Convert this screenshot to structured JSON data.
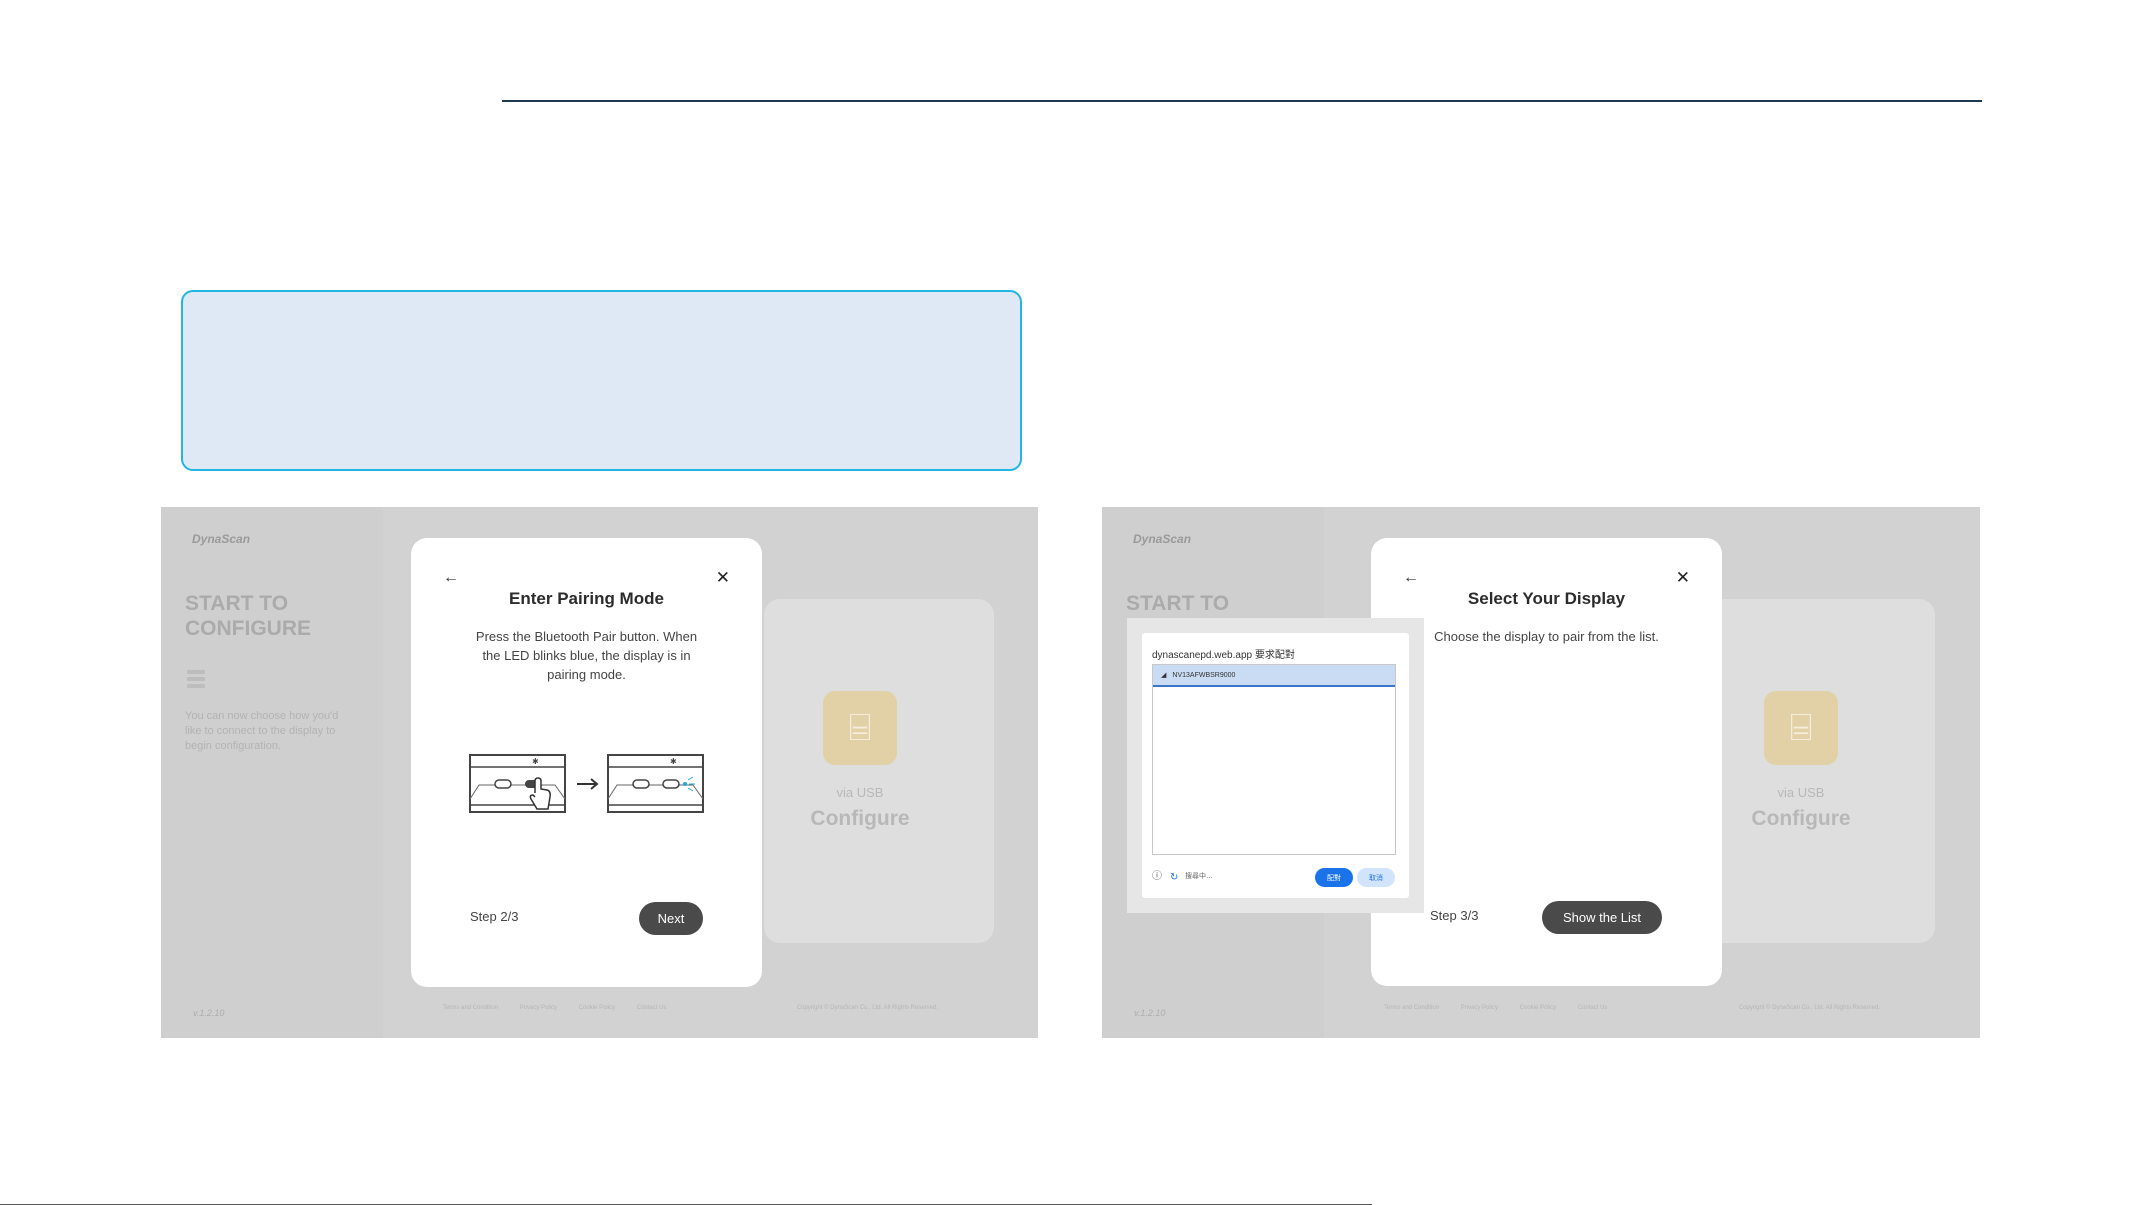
{
  "left_screen": {
    "brand": "DynaScan",
    "start_title": "START TO CONFIGURE",
    "side_description": "You can now choose how you'd like to connect to the display to begin configuration.",
    "version": "v.1.2.10",
    "footer_links": [
      "Terms and Condition",
      "Privacy Policy",
      "Cookie Policy",
      "Contact Us"
    ],
    "copyright": "Copyright © DynaScan Co., Ltd. All Rights Reserved.",
    "usb_card": {
      "via": "via USB",
      "title": "Configure"
    },
    "modal": {
      "title": "Enter Pairing Mode",
      "description": "Press the Bluetooth Pair button. When the LED blinks blue, the display is in pairing mode.",
      "step": "Step 2/3",
      "next_label": "Next"
    }
  },
  "right_screen": {
    "brand": "DynaScan",
    "start_title": "START TO",
    "version": "v.1.2.10",
    "footer_links": [
      "Terms and Condition",
      "Privacy Policy",
      "Cookie Policy",
      "Contact Us"
    ],
    "copyright": "Copyright © DynaScan Co., Ltd. All Rights Reserved.",
    "usb_card": {
      "via": "via USB",
      "title": "Configure"
    },
    "modal": {
      "title": "Select Your Display",
      "description": "Choose the display to pair from the list.",
      "step": "Step 3/3",
      "show_list_label": "Show the List"
    },
    "chooser": {
      "title": "dynascanepd.web.app 要求配對",
      "device": "NV13AFWBSR9000",
      "status": "搜尋中…",
      "pair_label": "配對",
      "cancel_label": "取消"
    }
  },
  "colors": {
    "rule": "#1e3a52",
    "callout_fill": "#dfe9f5",
    "callout_border": "#22b6e2",
    "button_dark": "#4a4a4a",
    "chooser_accent": "#1a73e8"
  }
}
